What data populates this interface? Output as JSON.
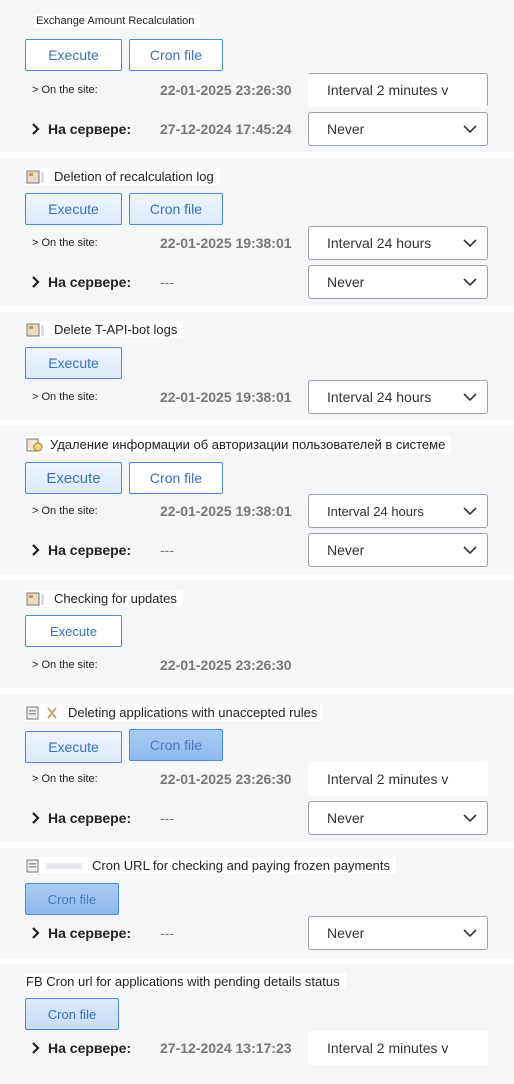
{
  "tasks": [
    {
      "title": "Exchange Amount Recalculation",
      "icon": "none",
      "execute_label": "Execute",
      "cron_label": "Cron file",
      "site_label": "> On the site:",
      "site_time": "22-01-2025 23:26:30",
      "site_interval": "Interval 2 minutes v",
      "server_label": "На сервере:",
      "server_time": "27-12-2024 17:45:24",
      "server_interval": "Never"
    },
    {
      "title": "Deletion of recalculation log",
      "icon": "log-icon",
      "execute_label": "Execute",
      "cron_label": "Cron file",
      "site_label": "> On the site:",
      "site_time": "22-01-2025 19:38:01",
      "site_interval": "Interval 24 hours",
      "server_label": "На сервере:",
      "server_time": "---",
      "server_interval": "Never"
    },
    {
      "title": "Delete T-API-bot logs",
      "icon": "log-icon",
      "execute_label": "Execute",
      "site_label": "> On the site:",
      "site_time": "22-01-2025 19:38:01",
      "site_interval": "Interval 24 hours"
    },
    {
      "title": "Удаление информации об авторизации пользователей в системе",
      "icon": "clock-icon",
      "execute_label": "Execute",
      "cron_label": "Cron file",
      "site_label": "> On the site:",
      "site_time": "22-01-2025 19:38:01",
      "site_interval": "Interval 24 hours",
      "server_label": "На сервере:",
      "server_time": "---",
      "server_interval": "Never"
    },
    {
      "title": "Checking for updates",
      "icon": "log-icon",
      "execute_label": "Execute",
      "site_label": "> On the site:",
      "site_time": "22-01-2025 23:26:30"
    },
    {
      "title": "Deleting applications with unaccepted rules",
      "icon": "clipboard-icon",
      "execute_label": "Execute",
      "cron_label": "Cron file",
      "site_label": "> On the site:",
      "site_time": "22-01-2025 23:26:30",
      "site_interval": "Interval 2 minutes v",
      "server_label": "На сервере:",
      "server_time": "---",
      "server_interval": "Never"
    },
    {
      "title": "Cron URL for checking and paying frozen payments",
      "icon": "clipboard-icon",
      "cron_label": "Cron file",
      "server_label": "На сервере:",
      "server_time": "---",
      "server_interval": "Never"
    },
    {
      "title": "FB Cron url for applications with pending details status",
      "icon": "none",
      "cron_label": "Cron file",
      "server_label": "На сервере:",
      "server_time": "27-12-2024 13:17:23",
      "server_interval": "Interval 2 minutes v"
    }
  ]
}
